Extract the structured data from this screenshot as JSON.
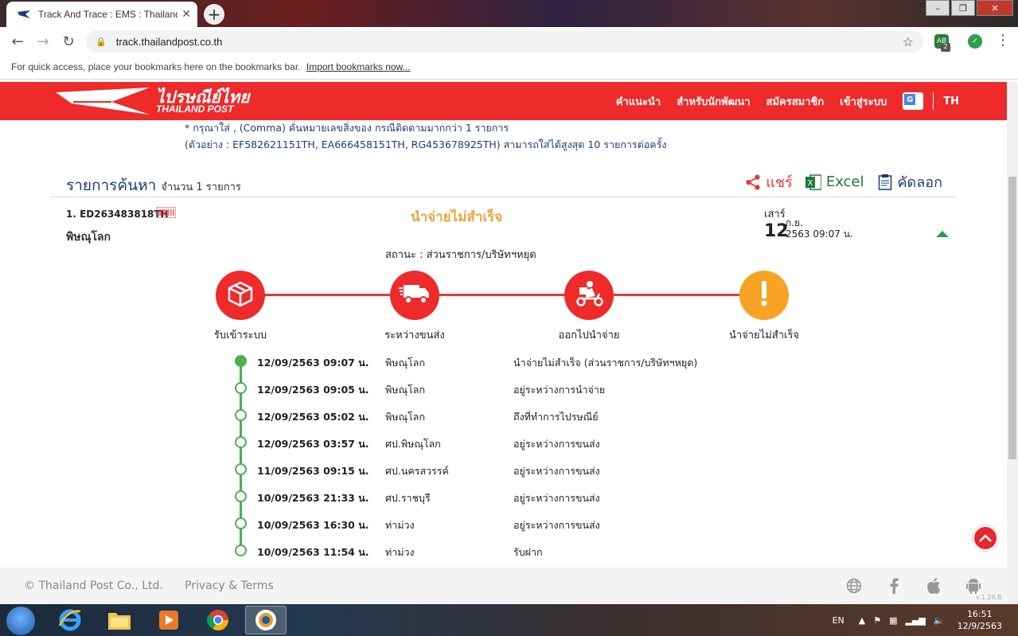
{
  "browser": {
    "tab_title": "Track And Trace : EMS : Thailand Post",
    "url": "track.thailandpost.co.th",
    "bookmarks_hint": "For quick access, place your bookmarks here on the bookmarks bar.",
    "bookmarks_import": "Import bookmarks now...",
    "ext_badge": "2"
  },
  "header": {
    "logo_th": "ไปรษณีย์ไทย",
    "logo_en": "THAILAND POST",
    "nav": [
      "คำแนะนำ",
      "สำหรับนักพัฒนา",
      "สมัครสมาชิก",
      "เข้าสู่ระบบ"
    ],
    "lang": "TH"
  },
  "hints": {
    "line1": "* กรุณาใส่ , (Comma) คั่นหมายเลขสิ่งของ กรณีติดตามมากกว่า 1 รายการ",
    "line2": "(ตัวอย่าง : EF582621151TH, EA666458151TH, RG453678925TH) สามารถใส่ได้สูงสุด 10 รายการต่อครั้ง"
  },
  "results": {
    "title": "รายการค้นหา",
    "count": "จำนวน 1 รายการ",
    "actions": {
      "share": "แชร์",
      "excel": "Excel",
      "copy": "คัดลอก"
    }
  },
  "item": {
    "tracking": "1. ED263483818TH",
    "origin": "พิษณุโลก",
    "status_head": "นำจ่ายไม่สำเร็จ",
    "day_name": "เสาร์",
    "day_num": "12",
    "month": "ก.ย.",
    "year_time": "2563  09:07 น.",
    "status_line": "สถานะ : ส่วนราชการ/บริษัทฯหยุด"
  },
  "steps": [
    {
      "label": "รับเข้าระบบ",
      "icon": "box-icon"
    },
    {
      "label": "ระหว่างขนส่ง",
      "icon": "truck-icon"
    },
    {
      "label": "ออกไปนำจ่าย",
      "icon": "scooter-icon"
    },
    {
      "label": "นำจ่ายไม่สำเร็จ",
      "icon": "exclamation-icon"
    }
  ],
  "history": [
    {
      "date": "12/09/2563 09:07 น.",
      "location": "พิษณุโลก",
      "status": "นำจ่ายไม่สำเร็จ (ส่วนราชการ/บริษัทฯหยุด)"
    },
    {
      "date": "12/09/2563 09:05 น.",
      "location": "พิษณุโลก",
      "status": "อยู่ระหว่างการนำจ่าย"
    },
    {
      "date": "12/09/2563 05:02 น.",
      "location": "พิษณุโลก",
      "status": "ถึงที่ทำการไปรษณีย์"
    },
    {
      "date": "12/09/2563 03:57 น.",
      "location": "ศป.พิษณุโลก",
      "status": "อยู่ระหว่างการขนส่ง"
    },
    {
      "date": "11/09/2563 09:15 น.",
      "location": "ศป.นครสวรรค์",
      "status": "อยู่ระหว่างการขนส่ง"
    },
    {
      "date": "10/09/2563 21:33 น.",
      "location": "ศป.ราชบุรี",
      "status": "อยู่ระหว่างการขนส่ง"
    },
    {
      "date": "10/09/2563 16:30 น.",
      "location": "ท่าม่วง",
      "status": "อยู่ระหว่างการขนส่ง"
    },
    {
      "date": "10/09/2563 11:54 น.",
      "location": "ท่าม่วง",
      "status": "รับฝาก"
    }
  ],
  "footer": {
    "copyright": "© Thailand Post Co., Ltd.",
    "privacy": "Privacy & Terms",
    "version": "v.1.29.B"
  },
  "taskbar": {
    "lang": "EN",
    "time": "16:51",
    "date": "12/9/2563"
  },
  "colors": {
    "brand_red": "#ee2a2a",
    "status_orange": "#f2a33a",
    "timeline_green": "#4caf50",
    "link_blue": "#1a3e7a"
  }
}
